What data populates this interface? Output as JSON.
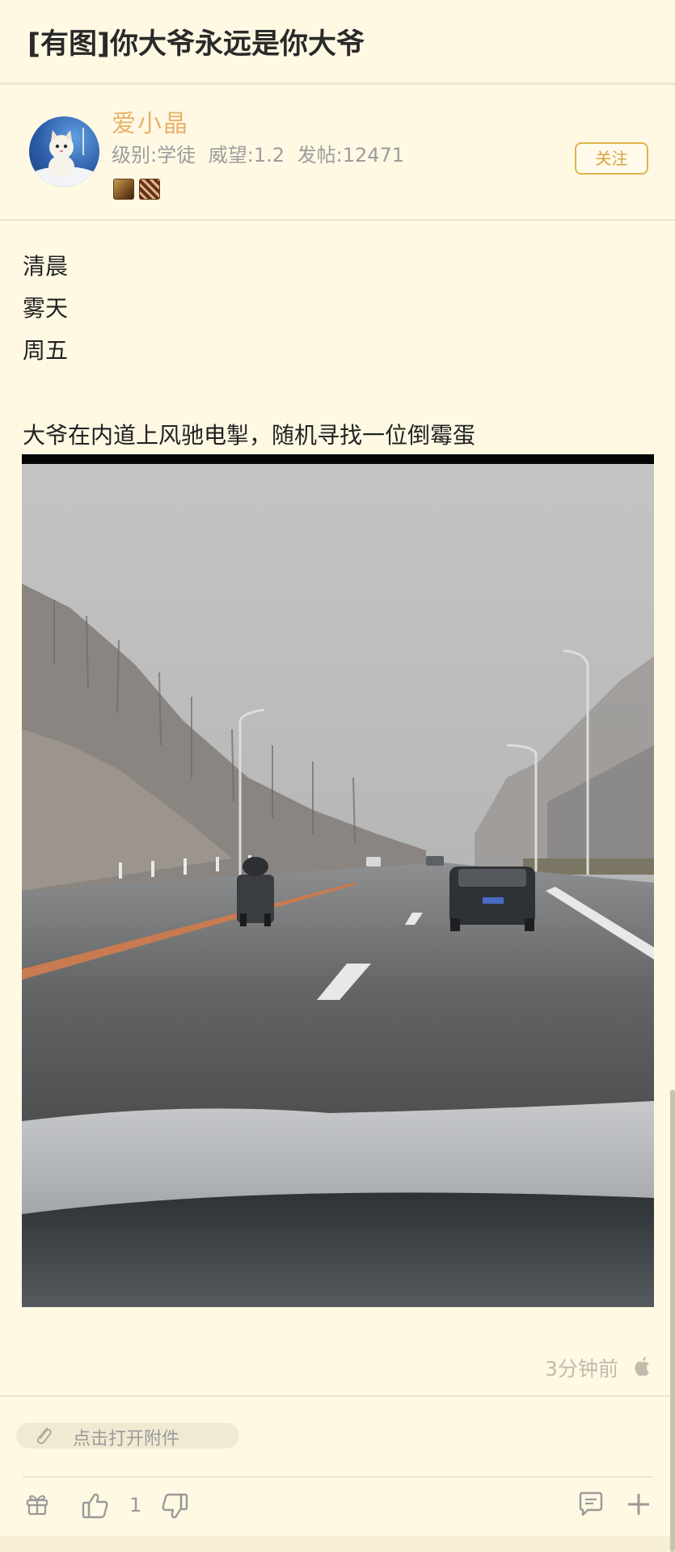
{
  "thread": {
    "title": "[有图]你大爷永远是你大爷"
  },
  "author": {
    "name": "爱小晶",
    "level": "级别:学徒",
    "prestige": "威望:1.2",
    "posts": "发帖:12471",
    "badges": [
      "badge-icon",
      "badge-icon"
    ],
    "follow_label": "关注"
  },
  "post": {
    "lines": [
      "清晨",
      "雾天",
      "周五",
      "大爷在内道上风驰电掣，随机寻找一位倒霉蛋"
    ],
    "time": "3分钟前",
    "device_icon": "apple-icon"
  },
  "attachment": {
    "label": "点击打开附件",
    "icon": "paperclip-icon"
  },
  "toolbar": {
    "like_count": "1",
    "icons": [
      "gift-icon",
      "thumbs-up-icon",
      "thumbs-down-icon",
      "comment-icon",
      "plus-icon"
    ]
  },
  "colors": {
    "background": "#fff9e4",
    "accent": "#e0b24c",
    "author_name": "#e8b26a",
    "muted_text": "#9d9d9d"
  }
}
